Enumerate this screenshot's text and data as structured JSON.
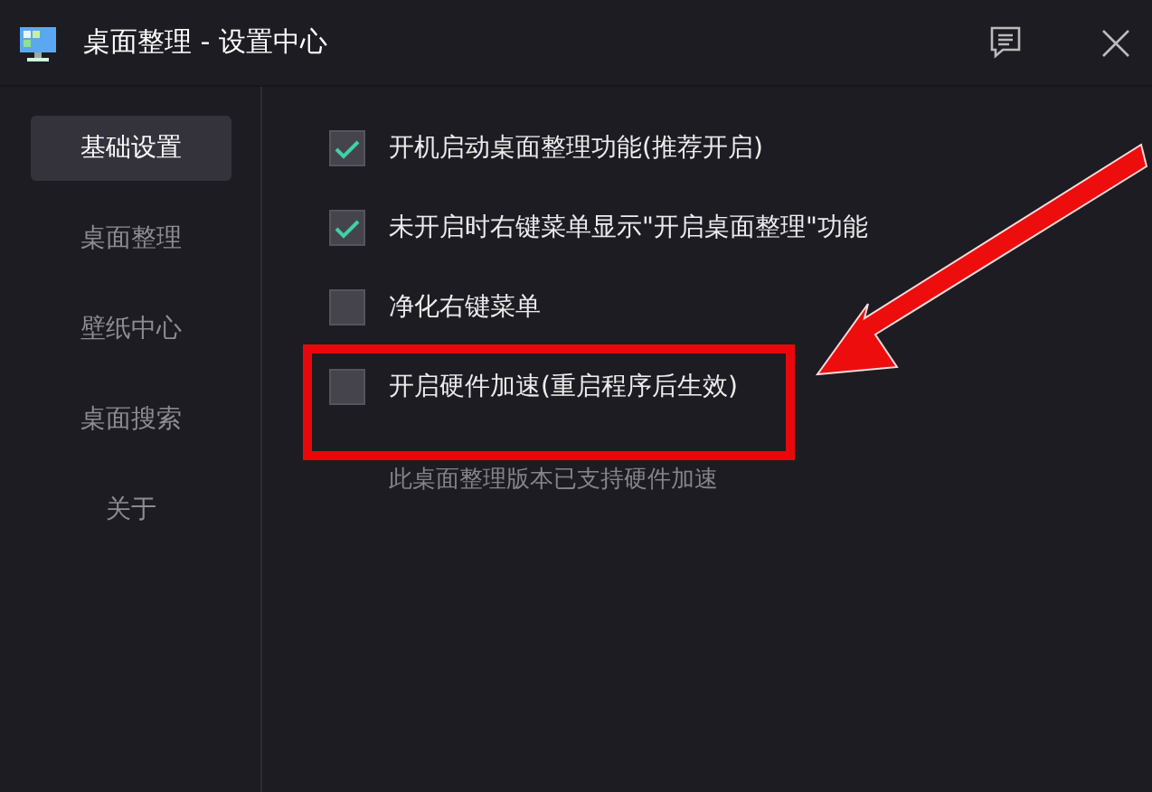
{
  "window": {
    "title": "桌面整理 - 设置中心"
  },
  "sidebar": {
    "items": [
      {
        "label": "基础设置",
        "selected": true
      },
      {
        "label": "桌面整理",
        "selected": false
      },
      {
        "label": "壁纸中心",
        "selected": false
      },
      {
        "label": "桌面搜索",
        "selected": false
      },
      {
        "label": "关于",
        "selected": false
      }
    ]
  },
  "options": [
    {
      "label": "开机启动桌面整理功能(推荐开启)",
      "checked": true
    },
    {
      "label": "未开启时右键菜单显示\"开启桌面整理\"功能",
      "checked": true
    },
    {
      "label": "净化右键菜单",
      "checked": false
    },
    {
      "label": "开启硬件加速(重启程序后生效)",
      "checked": false,
      "note": "此桌面整理版本已支持硬件加速"
    }
  ]
}
